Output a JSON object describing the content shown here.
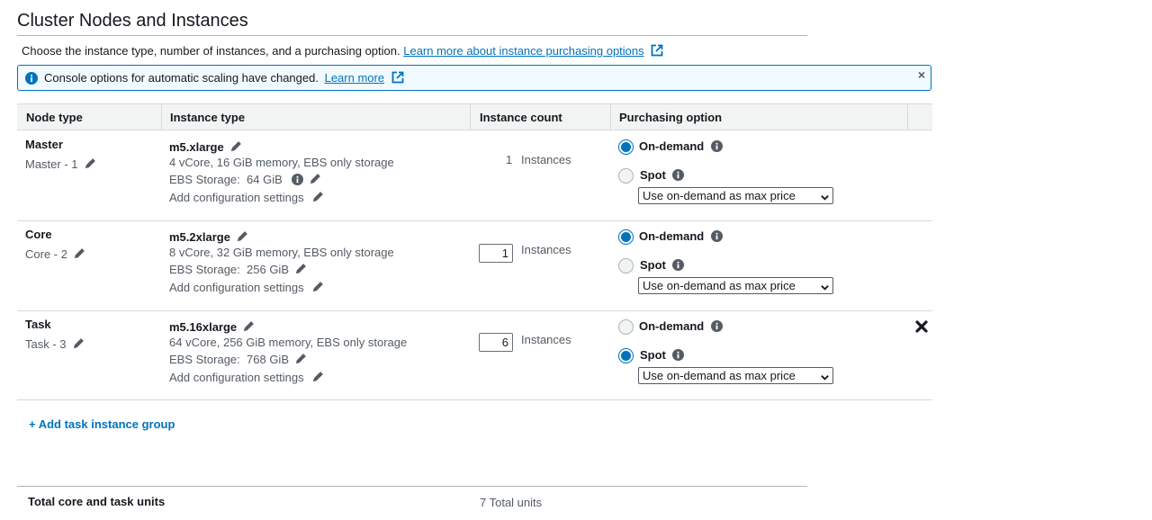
{
  "section": {
    "title": "Cluster Nodes and Instances",
    "description": "Choose the instance type, number of instances, and a purchasing option.",
    "learn_more_link": "Learn more about instance purchasing options"
  },
  "alert": {
    "message": "Console options for automatic scaling have changed.",
    "link": "Learn more",
    "close_symbol": "×"
  },
  "table": {
    "headers": [
      "Node type",
      "Instance type",
      "Instance count",
      "Purchasing option"
    ],
    "rows": [
      {
        "node_type": "Master",
        "node_name": "Master - 1",
        "instance_type": "m5.xlarge",
        "specs": "4 vCore, 16 GiB memory, EBS only storage",
        "ebs_label": "EBS Storage:",
        "ebs_value": "64 GiB",
        "config_label": "Add configuration settings",
        "count": "1",
        "count_suffix": "Instances",
        "on_demand_label": "On-demand",
        "spot_label": "Spot",
        "on_demand_selected": true,
        "spot_selected": false,
        "max_price": "Use on-demand as max price"
      },
      {
        "node_type": "Core",
        "node_name": "Core - 2",
        "instance_type": "m5.2xlarge",
        "specs": "8 vCore, 32 GiB memory, EBS only storage",
        "ebs_label": "EBS Storage:",
        "ebs_value": "256 GiB",
        "config_label": "Add configuration settings",
        "count": "1",
        "count_suffix": "Instances",
        "on_demand_label": "On-demand",
        "spot_label": "Spot",
        "on_demand_selected": true,
        "spot_selected": false,
        "max_price": "Use on-demand as max price"
      },
      {
        "node_type": "Task",
        "node_name": "Task - 3",
        "instance_type": "m5.16xlarge",
        "specs": "64 vCore, 256 GiB memory, EBS only storage",
        "ebs_label": "EBS Storage:",
        "ebs_value": "768 GiB",
        "config_label": "Add configuration settings",
        "count": "6",
        "count_suffix": "Instances",
        "on_demand_label": "On-demand",
        "spot_label": "Spot",
        "on_demand_selected": false,
        "spot_selected": true,
        "max_price": "Use on-demand as max price"
      }
    ]
  },
  "add_task_group": "+ Add task instance group",
  "totals": {
    "label": "Total core and task units",
    "value": "7 Total units"
  },
  "colors": {
    "link": "#0073bb",
    "header_bg": "#f2f3f3",
    "alert_bg": "#f1faff",
    "border": "#d5dbdb"
  },
  "icons": {
    "edit": "pencil-icon",
    "info": "info-icon",
    "external": "external-link-icon",
    "delete": "close-x-icon",
    "dropdown": "chevron-down-icon"
  }
}
